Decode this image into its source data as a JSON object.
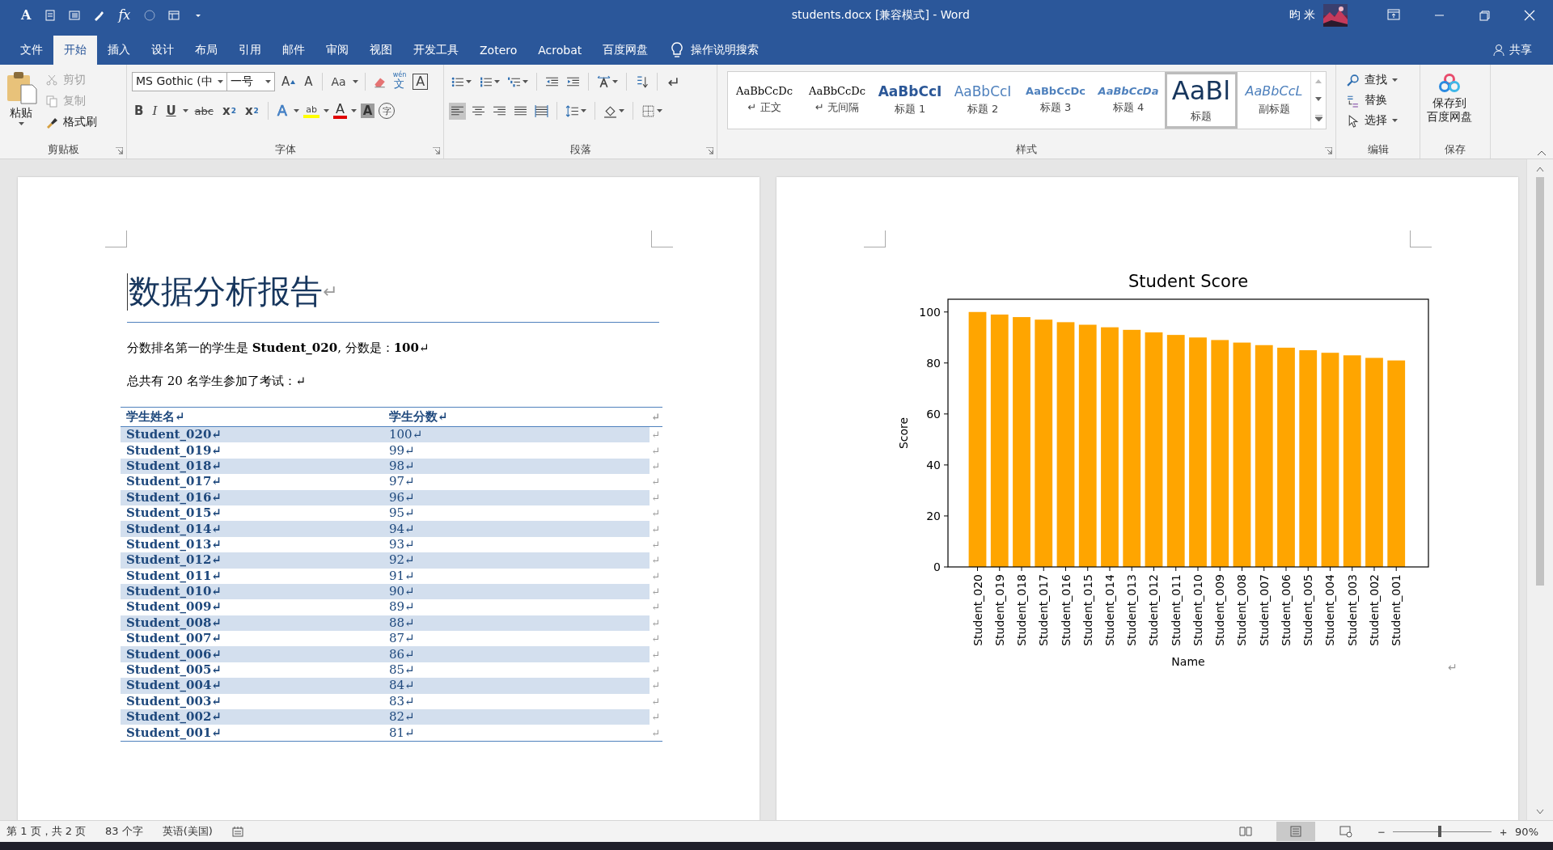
{
  "window": {
    "title": "students.docx [兼容模式]  -  Word",
    "user": "昀 米"
  },
  "quick_access": [
    {
      "kind": "font",
      "text": "A"
    },
    {
      "kind": "doc"
    },
    {
      "kind": "list"
    },
    {
      "kind": "brush"
    },
    {
      "kind": "formula",
      "text": "fx"
    },
    {
      "kind": "circle"
    },
    {
      "kind": "layout"
    },
    {
      "kind": "customize"
    }
  ],
  "tabs": [
    {
      "label": "文件",
      "selected": false
    },
    {
      "label": "开始",
      "selected": true
    },
    {
      "label": "插入",
      "selected": false
    },
    {
      "label": "设计",
      "selected": false
    },
    {
      "label": "布局",
      "selected": false
    },
    {
      "label": "引用",
      "selected": false
    },
    {
      "label": "邮件",
      "selected": false
    },
    {
      "label": "审阅",
      "selected": false
    },
    {
      "label": "视图",
      "selected": false
    },
    {
      "label": "开发工具",
      "selected": false
    },
    {
      "label": "Zotero",
      "selected": false
    },
    {
      "label": "Acrobat",
      "selected": false
    },
    {
      "label": "百度网盘",
      "selected": false
    }
  ],
  "tell_me": "操作说明搜索",
  "share": "共享",
  "ribbon": {
    "clipboard": {
      "label": "剪贴板",
      "paste": "粘贴",
      "items": [
        {
          "kind": "cut",
          "label": "剪切",
          "disabled": true
        },
        {
          "kind": "copy",
          "label": "复制",
          "disabled": true
        },
        {
          "kind": "painter",
          "label": "格式刷",
          "disabled": false
        }
      ]
    },
    "font": {
      "label": "字体",
      "name": "MS Gothic (中",
      "size": "一号",
      "row1": [
        {
          "kind": "grow",
          "text": "A"
        },
        {
          "kind": "shrink",
          "text": "A"
        },
        {
          "kind": "case",
          "text": "Aa"
        },
        {
          "kind": "clear"
        },
        {
          "kind": "phonetic",
          "text": "wén",
          "sub": "文"
        },
        {
          "kind": "border",
          "text": "A"
        }
      ],
      "row2": [
        {
          "kind": "bold",
          "text": "B"
        },
        {
          "kind": "italic",
          "text": "I"
        },
        {
          "kind": "underline",
          "text": "U"
        },
        {
          "kind": "strike",
          "text": "abc"
        },
        {
          "kind": "subscript",
          "text": "x",
          "script": "2"
        },
        {
          "kind": "superscript",
          "text": "x",
          "script": "2"
        },
        {
          "kind": "effects",
          "text": "A"
        },
        {
          "kind": "highlight",
          "text": "ab"
        },
        {
          "kind": "color",
          "text": "A"
        },
        {
          "kind": "shade",
          "text": "A"
        },
        {
          "kind": "enclose",
          "text": "字"
        }
      ]
    },
    "paragraph": {
      "label": "段落",
      "row1": [
        {
          "kind": "bullets"
        },
        {
          "kind": "numbering"
        },
        {
          "kind": "multilevel"
        },
        {
          "kind": "outdent"
        },
        {
          "kind": "indent"
        },
        {
          "kind": "asian"
        },
        {
          "kind": "sort"
        },
        {
          "kind": "marks"
        }
      ],
      "align": [
        {
          "kind": "left",
          "selected": true
        },
        {
          "kind": "center",
          "selected": false
        },
        {
          "kind": "right",
          "selected": false
        },
        {
          "kind": "justify",
          "selected": false
        },
        {
          "kind": "distribute",
          "selected": false
        }
      ],
      "row2": [
        {
          "kind": "spacing"
        },
        {
          "kind": "shading"
        },
        {
          "kind": "borders"
        }
      ]
    },
    "styles": {
      "label": "样式",
      "items": [
        {
          "kind": "normal",
          "sample": "AaBbCcDc",
          "name": "正文",
          "mark": "↵",
          "selected": false
        },
        {
          "kind": "normal",
          "sample": "AaBbCcDc",
          "name": "无间隔",
          "mark": "↵",
          "selected": false
        },
        {
          "kind": "h1",
          "sample": "AaBbCcI",
          "name": "标题 1",
          "selected": false
        },
        {
          "kind": "h2",
          "sample": "AaBbCcI",
          "name": "标题 2",
          "selected": false
        },
        {
          "kind": "h3",
          "sample": "AaBbCcDc",
          "name": "标题 3",
          "selected": false
        },
        {
          "kind": "h4",
          "sample": "AaBbCcDa",
          "name": "标题 4",
          "selected": false
        },
        {
          "kind": "title",
          "sample": "AaBl",
          "name": "标题",
          "selected": true
        },
        {
          "kind": "subtitle",
          "sample": "AaBbCcL",
          "name": "副标题",
          "selected": false
        }
      ]
    },
    "editing": {
      "label": "编辑",
      "items": [
        {
          "kind": "find",
          "label": "查找",
          "dropdown": true
        },
        {
          "kind": "replace",
          "label": "替换",
          "dropdown": false
        },
        {
          "kind": "select",
          "label": "选择",
          "dropdown": true
        }
      ]
    },
    "save": {
      "label": "保存",
      "button": [
        "保存到",
        "百度网盘"
      ]
    }
  },
  "document": {
    "title": "数据分析报告",
    "title_mark": "↵",
    "paragraphs": [
      "分数排名第一的学生是 **Student_020**, 分数是：**100**↵",
      "总共有 20 名学生参加了考试：↵"
    ],
    "table": {
      "columns": [
        "学生姓名↵",
        "学生分数↵"
      ],
      "header_end": "↵",
      "rows": [
        {
          "cells": [
            "Student_020↵",
            "100↵"
          ],
          "end": "↵"
        },
        {
          "cells": [
            "Student_019↵",
            "99↵"
          ],
          "end": "↵"
        },
        {
          "cells": [
            "Student_018↵",
            "98↵"
          ],
          "end": "↵"
        },
        {
          "cells": [
            "Student_017↵",
            "97↵"
          ],
          "end": "↵"
        },
        {
          "cells": [
            "Student_016↵",
            "96↵"
          ],
          "end": "↵"
        },
        {
          "cells": [
            "Student_015↵",
            "95↵"
          ],
          "end": "↵"
        },
        {
          "cells": [
            "Student_014↵",
            "94↵"
          ],
          "end": "↵"
        },
        {
          "cells": [
            "Student_013↵",
            "93↵"
          ],
          "end": "↵"
        },
        {
          "cells": [
            "Student_012↵",
            "92↵"
          ],
          "end": "↵"
        },
        {
          "cells": [
            "Student_011↵",
            "91↵"
          ],
          "end": "↵"
        },
        {
          "cells": [
            "Student_010↵",
            "90↵"
          ],
          "end": "↵"
        },
        {
          "cells": [
            "Student_009↵",
            "89↵"
          ],
          "end": "↵"
        },
        {
          "cells": [
            "Student_008↵",
            "88↵"
          ],
          "end": "↵"
        },
        {
          "cells": [
            "Student_007↵",
            "87↵"
          ],
          "end": "↵"
        },
        {
          "cells": [
            "Student_006↵",
            "86↵"
          ],
          "end": "↵"
        },
        {
          "cells": [
            "Student_005↵",
            "85↵"
          ],
          "end": "↵"
        },
        {
          "cells": [
            "Student_004↵",
            "84↵"
          ],
          "end": "↵"
        },
        {
          "cells": [
            "Student_003↵",
            "83↵"
          ],
          "end": "↵"
        },
        {
          "cells": [
            "Student_002↵",
            "82↵"
          ],
          "end": "↵"
        },
        {
          "cells": [
            "Student_001↵",
            "81↵"
          ],
          "end": "↵"
        }
      ]
    },
    "chart_data": {
      "type": "bar",
      "title": "Student Score",
      "xlabel": "Name",
      "ylabel": "Score",
      "categories": [
        "Student_020",
        "Student_019",
        "Student_018",
        "Student_017",
        "Student_016",
        "Student_015",
        "Student_014",
        "Student_013",
        "Student_012",
        "Student_011",
        "Student_010",
        "Student_009",
        "Student_008",
        "Student_007",
        "Student_006",
        "Student_005",
        "Student_004",
        "Student_003",
        "Student_002",
        "Student_001"
      ],
      "series": [
        {
          "color": "#ffa500",
          "values": [
            100,
            99,
            98,
            97,
            96,
            95,
            94,
            93,
            92,
            91,
            90,
            89,
            88,
            87,
            86,
            85,
            84,
            83,
            82,
            81
          ]
        }
      ],
      "ylim": [
        0,
        105
      ],
      "yticks": [
        0,
        20,
        40,
        60,
        80,
        100
      ]
    },
    "chart_mark": "↵"
  },
  "status_bar": {
    "items": [
      "第 1 页，共 2 页",
      "83 个字",
      "英语(美国)"
    ],
    "views": [
      {
        "kind": "read",
        "selected": false
      },
      {
        "kind": "print",
        "selected": true
      },
      {
        "kind": "web",
        "selected": false
      }
    ],
    "zoom_out": "−",
    "zoom_in": "+",
    "zoom": {
      "level": 0.46
    },
    "zoom_text": "90%"
  }
}
